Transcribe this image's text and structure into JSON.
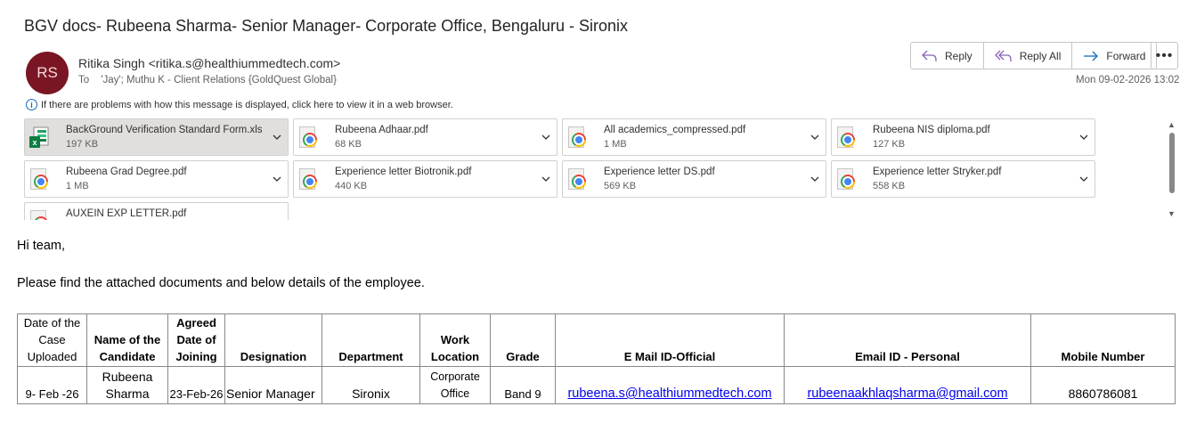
{
  "email": {
    "subject": "BGV docs- Rubeena Sharma- Senior Manager- Corporate Office, Bengaluru - Sironix",
    "avatar_initials": "RS",
    "avatar_color": "#7a1624",
    "sender": "Ritika Singh <ritika.s@healthiummedtech.com>",
    "to_label": "To",
    "recipients": "'Jay'; Muthu K - Client Relations {GoldQuest Global}",
    "date": "Mon 09-02-2026 13:02",
    "info_message": "If there are problems with how this message is displayed, click here to view it in a web browser."
  },
  "actions": {
    "reply": "Reply",
    "reply_all": "Reply All",
    "forward": "Forward",
    "more": "•••"
  },
  "attachments": [
    {
      "name": "BackGround Verification Standard Form.xls",
      "size": "197 KB",
      "icon": "excel-icon"
    },
    {
      "name": "Rubeena Adhaar.pdf",
      "size": "68 KB",
      "icon": "chrome-pdf-icon"
    },
    {
      "name": "All academics_compressed.pdf",
      "size": "1 MB",
      "icon": "chrome-pdf-icon"
    },
    {
      "name": "Rubeena NIS diploma.pdf",
      "size": "127 KB",
      "icon": "chrome-pdf-icon"
    },
    {
      "name": "Rubeena Grad Degree.pdf",
      "size": "1 MB",
      "icon": "chrome-pdf-icon"
    },
    {
      "name": "Experience letter Biotronik.pdf",
      "size": "440 KB",
      "icon": "chrome-pdf-icon"
    },
    {
      "name": "Experience letter DS.pdf",
      "size": "569 KB",
      "icon": "chrome-pdf-icon"
    },
    {
      "name": "Experience letter Stryker.pdf",
      "size": "558 KB",
      "icon": "chrome-pdf-icon"
    },
    {
      "name": "AUXEIN EXP LETTER.pdf",
      "size": "",
      "icon": "chrome-pdf-icon"
    }
  ],
  "body": {
    "greeting": "Hi team,",
    "intro": "Please find the attached documents and below details of the employee."
  },
  "table": {
    "headers": {
      "date_case_uploaded": "Date of the Case Uploaded",
      "name": "Name of the Candidate",
      "agreed_doj": "Agreed Date of Joining",
      "designation": "Designation",
      "department": "Department",
      "work_location": "Work Location",
      "grade": "Grade",
      "email_official": "E Mail ID-Official",
      "email_personal": "Email ID - Personal",
      "mobile": "Mobile Number"
    },
    "row": {
      "date_case_uploaded": "9- Feb -26",
      "name": "Rubeena Sharma",
      "agreed_doj": "23-Feb-26",
      "designation": "Senior Manager",
      "department": "Sironix",
      "work_location": "Corporate Office",
      "grade": "Band 9",
      "email_official": "rubeena.s@healthiummedtech.com",
      "email_personal": "rubeenaakhlaqsharma@gmail.com",
      "mobile": "8860786081"
    }
  }
}
